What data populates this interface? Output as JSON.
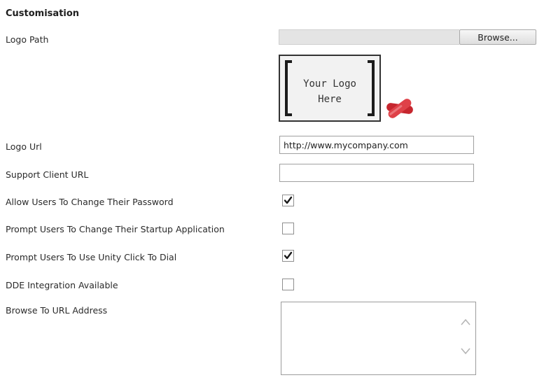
{
  "section": {
    "title": "Customisation"
  },
  "logo_path": {
    "label": "Logo Path",
    "file_value": "",
    "browse_label": "Browse..."
  },
  "logo_preview": {
    "text_line1": "Your Logo",
    "text_line2": "Here",
    "delete_icon": "red-x-icon"
  },
  "logo_url": {
    "label": "Logo Url",
    "value": "http://www.mycompany.com"
  },
  "support_client_url": {
    "label": "Support Client URL",
    "value": ""
  },
  "checkboxes": [
    {
      "label": "Allow Users To Change Their Password",
      "checked": true
    },
    {
      "label": "Prompt Users To Change Their Startup Application",
      "checked": false
    },
    {
      "label": "Prompt Users To Use Unity Click To Dial",
      "checked": true
    },
    {
      "label": "DDE Integration Available",
      "checked": false
    }
  ],
  "browse_to_url": {
    "label": "Browse To URL Address",
    "value": ""
  },
  "colors": {
    "delete_icon": "#d8333a",
    "checkmark": "#1a1a1a"
  }
}
